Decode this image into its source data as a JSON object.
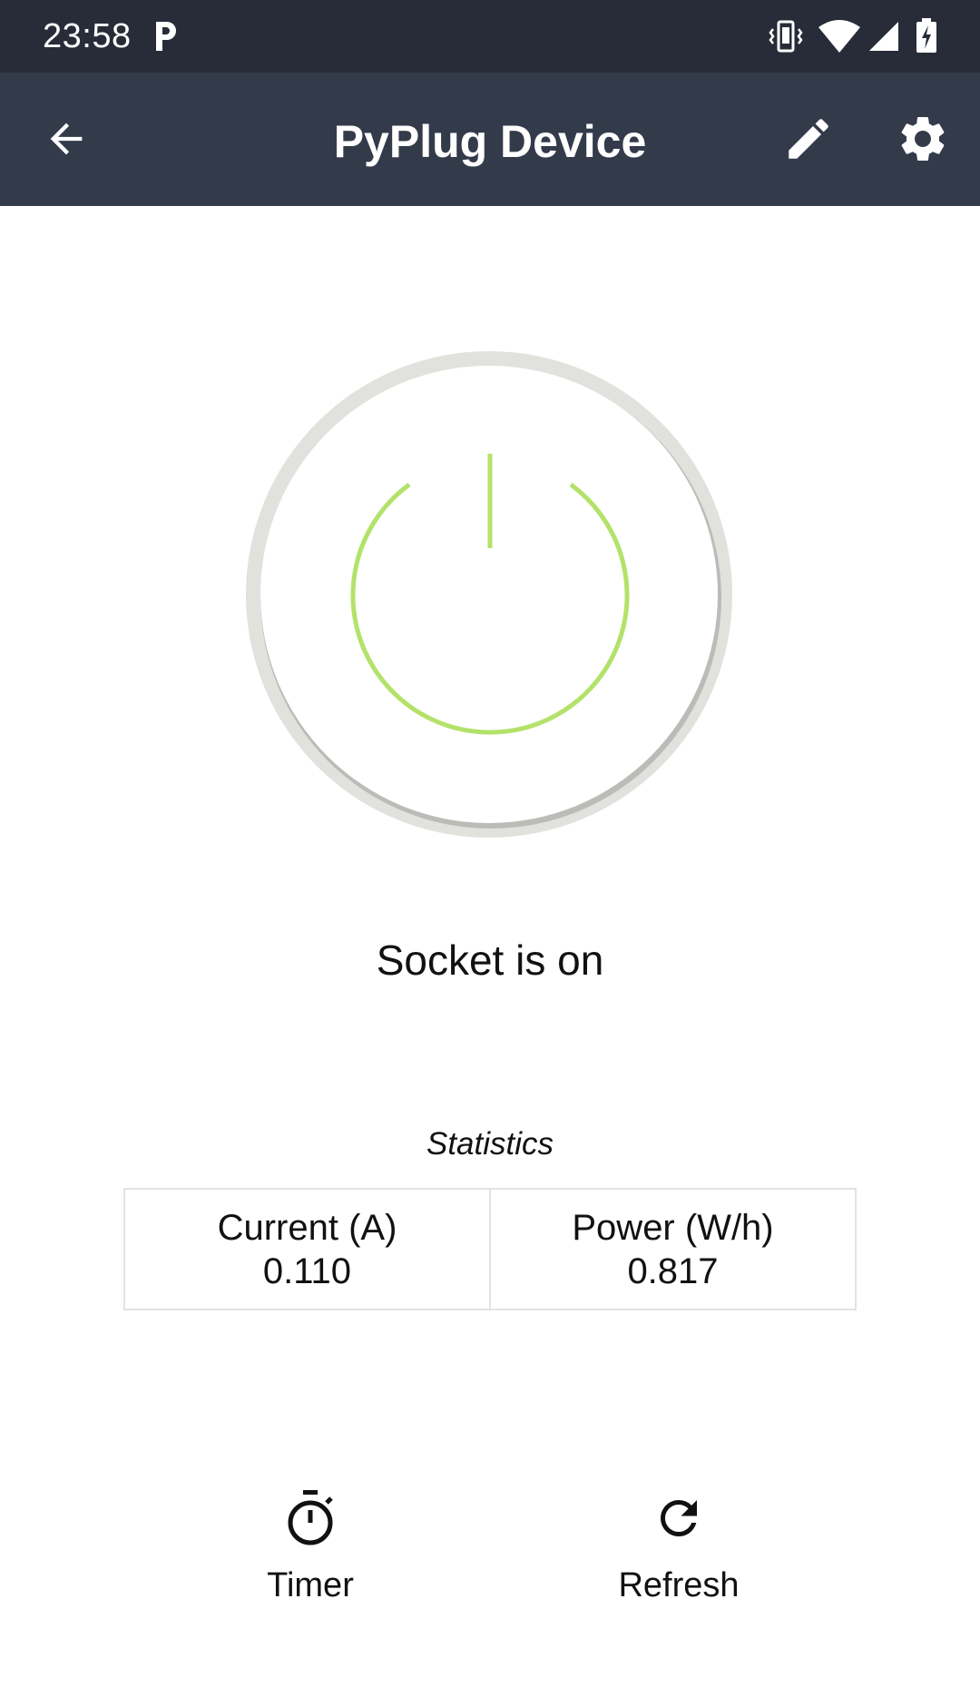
{
  "status_bar": {
    "time": "23:58",
    "app_icon": "parking-p-icon",
    "icons": [
      "vibrate-icon",
      "wifi-icon",
      "cell-signal-icon",
      "battery-charging-icon"
    ]
  },
  "app_bar": {
    "title": "PyPlug Device",
    "back_icon": "arrow-back-icon",
    "edit_icon": "pencil-icon",
    "settings_icon": "gear-icon"
  },
  "power": {
    "icon": "power-icon",
    "color": "#b3e26a",
    "status_text": "Socket is on"
  },
  "statistics": {
    "title": "Statistics",
    "items": [
      {
        "label": "Current (A)",
        "value": "0.110"
      },
      {
        "label": "Power (W/h)",
        "value": "0.817"
      }
    ]
  },
  "actions": {
    "timer_label": "Timer",
    "refresh_label": "Refresh"
  },
  "colors": {
    "status_bar": "#272c38",
    "app_bar": "#333b4b",
    "accent": "#b3e26a"
  }
}
